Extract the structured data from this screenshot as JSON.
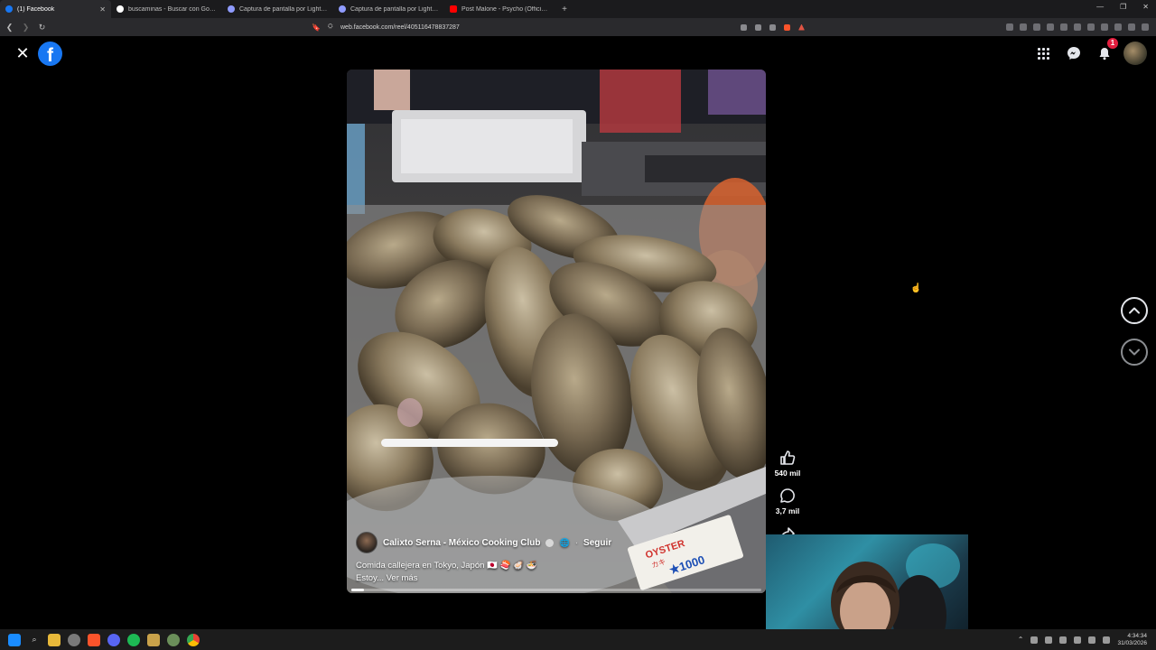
{
  "browser": {
    "tabs": [
      {
        "title": "(1) Facebook",
        "active": true,
        "favicon_color": "#1877f2"
      },
      {
        "title": "buscaminas - Buscar con Google",
        "active": false,
        "favicon_color": "#ffffff"
      },
      {
        "title": "Captura de pantalla por Lightshot",
        "active": false,
        "favicon_color": "#8f9bff"
      },
      {
        "title": "Captura de pantalla por Lightshot",
        "active": false,
        "favicon_color": "#8f9bff"
      },
      {
        "title": "Post Malone - Psycho (Official Music",
        "active": false,
        "favicon_color": "#ff0000"
      }
    ],
    "url": "web.facebook.com/reel/405116478837287"
  },
  "reel": {
    "author": "Calixto Serna - México Cooking Club",
    "follow_label": "Seguir",
    "caption_line1": "Comida callejera en Tokyo, Japón 🇯🇵 🍣 🦪 🍜",
    "caption_line2": "Estoy...",
    "see_more": "Ver más",
    "likes": "540 mil",
    "comments": "3,7 mil",
    "price_tag": "OYSTER ★1000",
    "progress_percent": 3
  },
  "header": {
    "notification_count": "1"
  },
  "taskbar": {
    "time": "4:34:34",
    "date": "31/03/2026"
  },
  "colors": {
    "facebook_blue": "#1877f2",
    "notification_red": "#e41e3f"
  }
}
